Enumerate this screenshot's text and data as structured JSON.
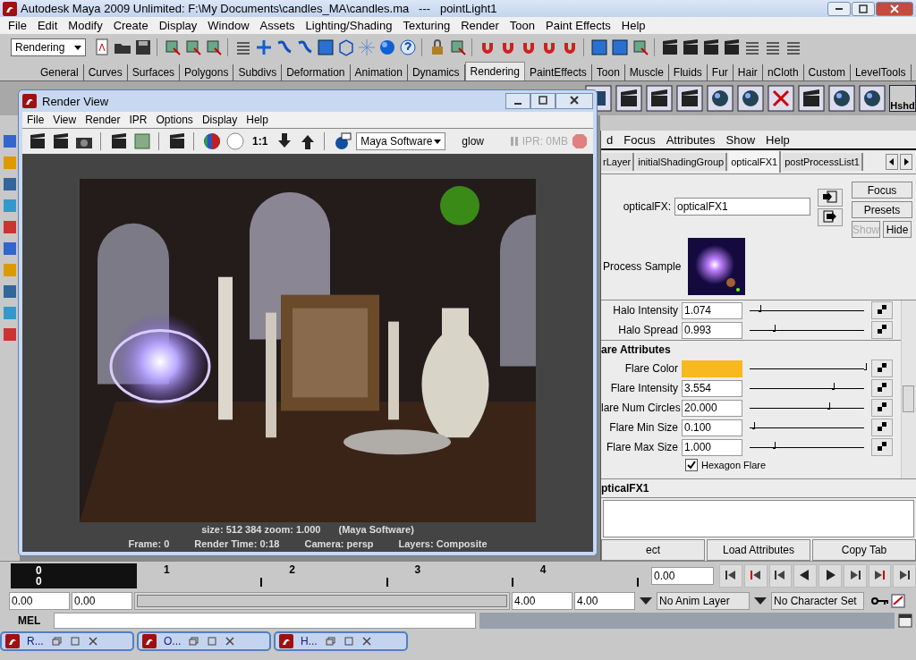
{
  "window": {
    "title": "Autodesk Maya 2009 Unlimited: F:\\My Documents\\candles_MA\\candles.ma   ---   pointLight1"
  },
  "menu_bar": [
    "File",
    "Edit",
    "Modify",
    "Create",
    "Display",
    "Window",
    "Assets",
    "Lighting/Shading",
    "Texturing",
    "Render",
    "Toon",
    "Paint Effects",
    "Help"
  ],
  "status_line": {
    "menu_set": "Rendering"
  },
  "shelf_tabs": [
    {
      "label": "General",
      "selected": false
    },
    {
      "label": "Curves",
      "selected": false
    },
    {
      "label": "Surfaces",
      "selected": false
    },
    {
      "label": "Polygons",
      "selected": false
    },
    {
      "label": "Subdivs",
      "selected": false
    },
    {
      "label": "Deformation",
      "selected": false
    },
    {
      "label": "Animation",
      "selected": false
    },
    {
      "label": "Dynamics",
      "selected": false
    },
    {
      "label": "Rendering",
      "selected": true
    },
    {
      "label": "PaintEffects",
      "selected": false
    },
    {
      "label": "Toon",
      "selected": false
    },
    {
      "label": "Muscle",
      "selected": false
    },
    {
      "label": "Fluids",
      "selected": false
    },
    {
      "label": "Fur",
      "selected": false
    },
    {
      "label": "Hair",
      "selected": false
    },
    {
      "label": "nCloth",
      "selected": false
    },
    {
      "label": "Custom",
      "selected": false
    },
    {
      "label": "LevelTools",
      "selected": false
    }
  ],
  "shelf": {
    "last_button": "Hshd"
  },
  "render_view": {
    "title": "Render View",
    "menu": [
      "File",
      "View",
      "Render",
      "IPR",
      "Options",
      "Display",
      "Help"
    ],
    "zoom_button": "1:1",
    "renderer": "Maya Software",
    "layer": "glow",
    "ipr_memory": "IPR: 0MB",
    "size_info": "size:  512  384 zoom: 1.000",
    "renderer_info": "(Maya Software)",
    "frame": "Frame: 0",
    "render_time": "Render Time: 0:18",
    "camera": "Camera: persp",
    "layers": "Layers: Composite"
  },
  "attribute_editor": {
    "menu": [
      "d",
      "Focus",
      "Attributes",
      "Show",
      "Help"
    ],
    "tabs": [
      {
        "label": "rLayer",
        "selected": false
      },
      {
        "label": "initialShadingGroup",
        "selected": false
      },
      {
        "label": "opticalFX1",
        "selected": true
      },
      {
        "label": "postProcessList1",
        "selected": false
      }
    ],
    "node_label": "opticalFX:",
    "node_value": "opticalFX1",
    "buttons": [
      {
        "label": "Focus",
        "disabled": false
      },
      {
        "label": "Presets",
        "disabled": false
      },
      {
        "label": "Show",
        "disabled": true
      },
      {
        "label": "Hide",
        "disabled": false
      }
    ],
    "sample_label": "Process Sample",
    "rows_above": [
      {
        "kind": "number",
        "label": "Halo Intensity",
        "value": "1.074",
        "level": 0.08
      },
      {
        "kind": "number",
        "label": "Halo Spread",
        "value": "0.993",
        "level": 0.2
      }
    ],
    "section": "are Attributes",
    "rows": [
      {
        "kind": "color",
        "label": "Flare Color",
        "color": "#f8b820",
        "level": 1
      },
      {
        "kind": "number",
        "label": "Flare Intensity",
        "value": "3.554",
        "level": 0.72
      },
      {
        "kind": "number",
        "label": "lare Num Circles",
        "value": "20.000",
        "level": 0.68
      },
      {
        "kind": "number",
        "label": "Flare Min Size",
        "value": "0.100",
        "level": 0.02
      },
      {
        "kind": "number",
        "label": "Flare Max Size",
        "value": "1.000",
        "level": 0.2
      }
    ],
    "checkbox": {
      "label": "Hexagon Flare",
      "checked": true
    },
    "notes_title": "pticalFX1",
    "bottom_buttons": [
      "ect",
      "Load Attributes",
      "Copy Tab"
    ]
  },
  "time_slider": {
    "current_frame": [
      "0",
      "0"
    ],
    "frames": [
      "1",
      "2",
      "3",
      "4"
    ],
    "current_time": "0.00"
  },
  "range_slider": {
    "start_time": "0.00",
    "playback_start": "0.00",
    "level": 1,
    "playback_end": "4.00",
    "end_time": "4.00",
    "anim_layer": "No Anim Layer",
    "character_set": "No Character Set"
  },
  "command_line": {
    "label": "MEL"
  },
  "taskbar": [
    "R...",
    "O...",
    "H..."
  ]
}
